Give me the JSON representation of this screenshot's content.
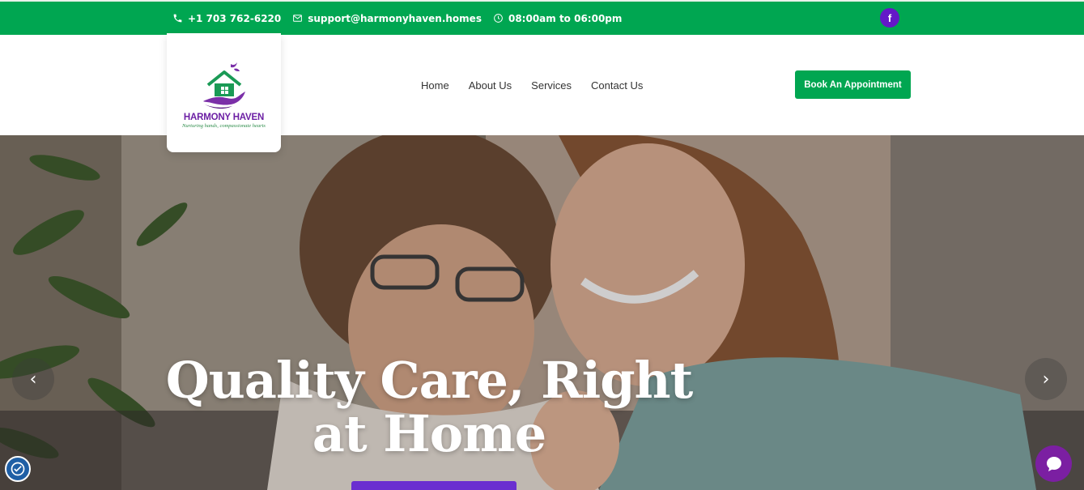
{
  "topbar": {
    "phone": "+1 703 762-6220",
    "email": "support@harmonyhaven.homes",
    "hours": "08:00am to 06:00pm",
    "social_fb": "f"
  },
  "logo": {
    "name": "HARMONY HAVEN",
    "tagline": "Nurturing hands, compassionate hearts"
  },
  "nav": {
    "items": [
      "Home",
      "About Us",
      "Services",
      "Contact Us"
    ]
  },
  "cta": {
    "label": "Book An Appointment"
  },
  "hero": {
    "title_line1": "Quality Care, Right",
    "title_line2": "at Home",
    "prev_arrow": "‹",
    "next_arrow": "›"
  },
  "colors": {
    "brand_green": "#00a651",
    "brand_purple": "#6c1fa4",
    "fb_purple": "#6418c8",
    "chat_purple": "#7b1fa2"
  },
  "icons": [
    "phone-icon",
    "mail-icon",
    "clock-icon",
    "facebook-icon",
    "chevron-left-icon",
    "chevron-right-icon",
    "accessibility-icon",
    "chat-icon"
  ]
}
